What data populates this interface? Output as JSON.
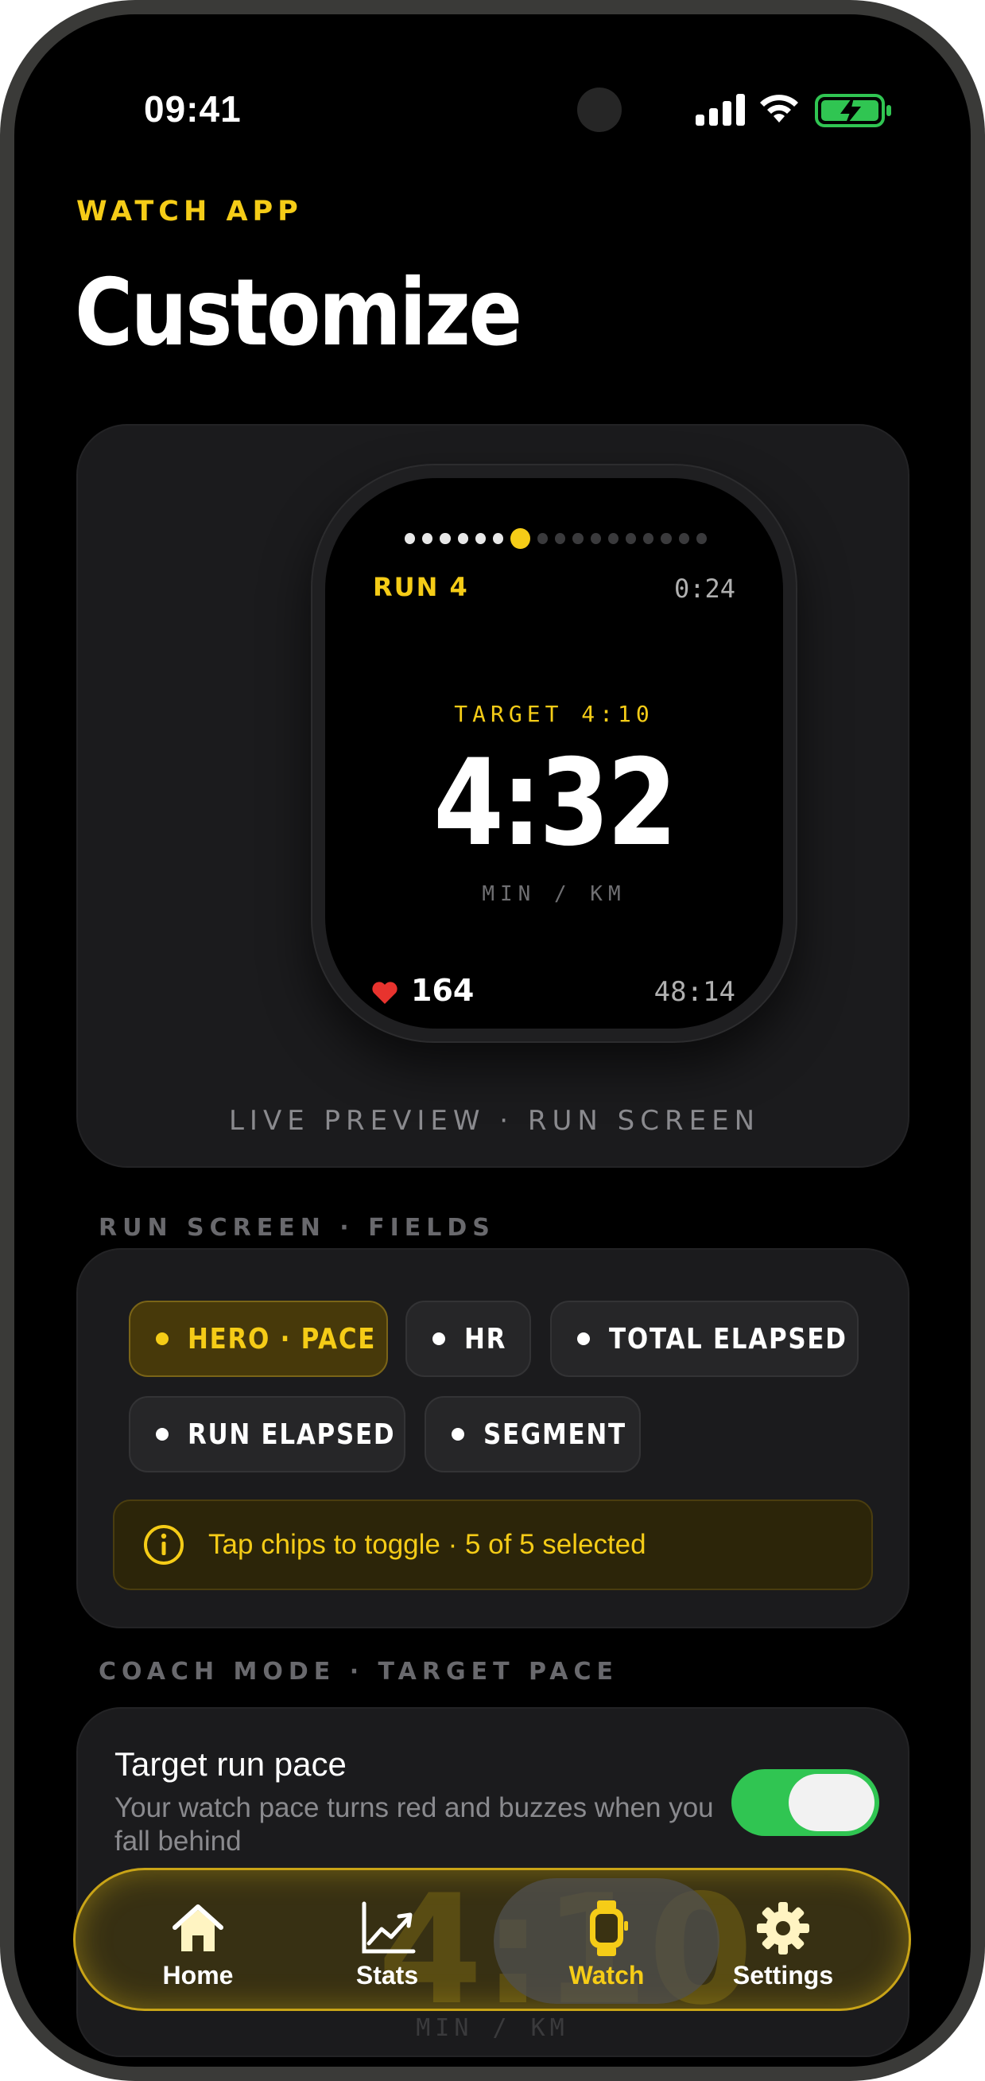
{
  "status_bar": {
    "time": "09:41",
    "icons": [
      "signal-icon",
      "wifi-icon",
      "battery-charging-icon"
    ]
  },
  "header": {
    "eyebrow": "WATCH APP",
    "title": "Customize"
  },
  "preview": {
    "run_label": "RUN 4",
    "run_time": "0:24",
    "target": "TARGET 4:10",
    "pace": "4:32",
    "unit": "MIN / KM",
    "heart_rate": "164",
    "total_time": "48:14",
    "caption": "LIVE PREVIEW · RUN SCREEN",
    "page_dots_total": 17,
    "page_dot_active": 7
  },
  "fields": {
    "section_label": "RUN SCREEN · FIELDS",
    "chips": [
      {
        "label": "HERO · PACE",
        "selected": true
      },
      {
        "label": "HR",
        "selected": false
      },
      {
        "label": "TOTAL ELAPSED",
        "selected": false
      },
      {
        "label": "RUN ELAPSED",
        "selected": false
      },
      {
        "label": "SEGMENT",
        "selected": false
      }
    ],
    "hint": "Tap chips to toggle · 5 of 5 selected"
  },
  "coach": {
    "section_label": "COACH MODE · TARGET PACE",
    "title": "Target run pace",
    "description": "Your watch pace turns red and buzzes when you fall behind",
    "enabled": true
  },
  "tabbar": {
    "tabs": [
      {
        "label": "Home",
        "icon": "home-icon",
        "active": false
      },
      {
        "label": "Stats",
        "icon": "chart-icon",
        "active": false
      },
      {
        "label": "Watch",
        "icon": "watch-icon",
        "active": true
      },
      {
        "label": "Settings",
        "icon": "gear-icon",
        "active": false
      }
    ],
    "ghost_pace": "4:10",
    "ghost_unit": "MIN / KM"
  },
  "colors": {
    "accent": "#f5cc17",
    "toggle_on": "#30c552",
    "heart": "#e8332e"
  }
}
